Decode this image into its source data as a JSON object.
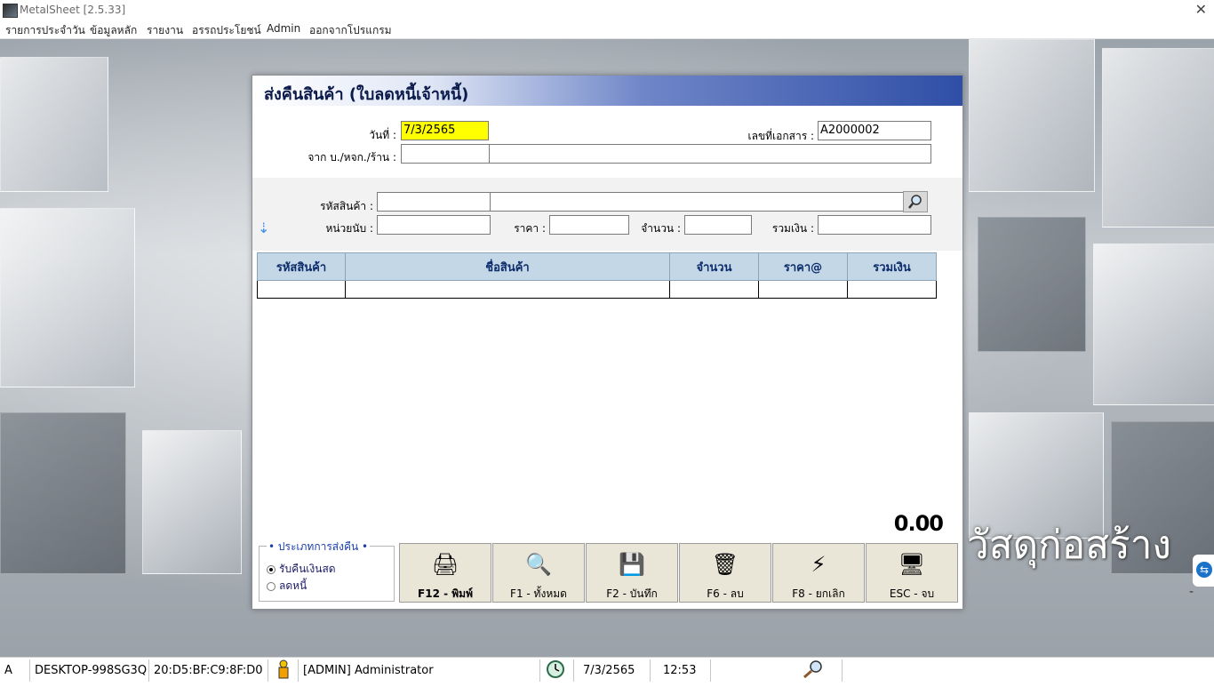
{
  "window": {
    "title": "MetalSheet [2.5.33]",
    "close_glyph": "✕"
  },
  "menu": [
    "รายการประจำวัน",
    "ข้อมูลหลัก",
    "รายงาน",
    "อรรถประโยชน์",
    "Admin",
    "ออกจากโปรแกรม"
  ],
  "dialog": {
    "title": "ส่งคืนสินค้า (ใบลดหนี้เจ้าหนี้)",
    "date_label": "วันที่ :",
    "date_value": "7/3/2565",
    "doc_no_label": "เลขที่เอกสาร :",
    "doc_no_value": "A2000002",
    "from_label": "จาก บ./หจก./ร้าน :",
    "from_code": "",
    "from_name": "",
    "product_code_label": "รหัสสินค้า :",
    "product_code": "",
    "product_name": "",
    "unit_label": "หน่วยนับ :",
    "unit": "",
    "price_label": "ราคา :",
    "price": "",
    "qty_label": "จำนวน :",
    "qty": "",
    "sum_label": "รวมเงิน :",
    "sum": "",
    "table": {
      "headers": [
        "รหัสสินค้า",
        "ชื่อสินค้า",
        "จำนวน",
        "ราคา@",
        "รวมเงิน"
      ],
      "rows": [
        [
          "",
          "",
          "",
          "",
          ""
        ]
      ]
    },
    "total": "0.00",
    "return_type": {
      "legend": "• ประเภทการส่งคืน •",
      "options": [
        {
          "label": "รับคืนเงินสด",
          "selected": true
        },
        {
          "label": "ลดหนี้",
          "selected": false
        }
      ]
    },
    "buttons": [
      {
        "label": "F12 - พิมพ์",
        "icon": "printer-icon",
        "glyph": "🖨"
      },
      {
        "label": "F1 - ทั้งหมด",
        "icon": "magnifier-icon",
        "glyph": "🔍"
      },
      {
        "label": "F2 - บันทึก",
        "icon": "floppy-disk-icon",
        "glyph": "💾"
      },
      {
        "label": "F6 - ลบ",
        "icon": "trash-icon",
        "glyph": "🗑"
      },
      {
        "label": "F8 - ยกเลิก",
        "icon": "lightning-icon",
        "glyph": "⚡"
      },
      {
        "label": "ESC - จบ",
        "icon": "monitor-icon",
        "glyph": "🖥"
      }
    ]
  },
  "brand": "วัสดุก่อสร้าง",
  "statusbar": {
    "mode": "A",
    "computer": "DESKTOP-998SG3Q",
    "mac": "20:D5:BF:C9:8F:D0",
    "user": "[ADMIN] Administrator",
    "date": "7/3/2565",
    "time": "12:53"
  },
  "colors": {
    "date_field": "#ffff00",
    "header_blue": "#2f4ea6",
    "table_header": "#c3d7e6"
  }
}
